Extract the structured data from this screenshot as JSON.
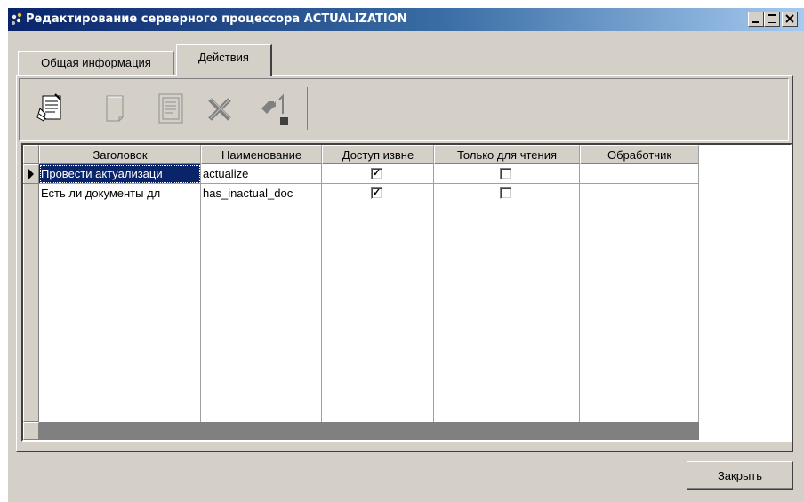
{
  "window": {
    "title": "Редактирование серверного процессора ACTUALIZATION",
    "controls": [
      "minimize-icon",
      "maximize-icon",
      "close-icon"
    ]
  },
  "tabs": [
    {
      "label": "Общая информация",
      "active": false
    },
    {
      "label": "Действия",
      "active": true
    }
  ],
  "toolbar": {
    "buttons": [
      {
        "name": "properties-icon",
        "enabled": true
      },
      {
        "name": "new-document-icon",
        "enabled": false
      },
      {
        "name": "edit-document-icon",
        "enabled": false
      },
      {
        "name": "delete-icon",
        "enabled": false
      },
      {
        "name": "move-down-icon",
        "enabled": false
      }
    ]
  },
  "grid": {
    "columns": [
      "Заголовок",
      "Наименование",
      "Доступ извне",
      "Только для чтения",
      "Обработчик"
    ],
    "rows": [
      {
        "title": "Провести актуализаци",
        "name": "actualize",
        "external_access": true,
        "read_only": false,
        "handler": "",
        "selected": true
      },
      {
        "title": "Есть ли документы дл",
        "name": "has_inactual_doc",
        "external_access": true,
        "read_only": false,
        "handler": "",
        "selected": false
      }
    ]
  },
  "footer": {
    "close_label": "Закрыть"
  },
  "colors": {
    "title_bar_start": "#0a246a",
    "title_bar_end": "#a6caf0",
    "face": "#d4d0c8",
    "selection": "#0a246a"
  }
}
